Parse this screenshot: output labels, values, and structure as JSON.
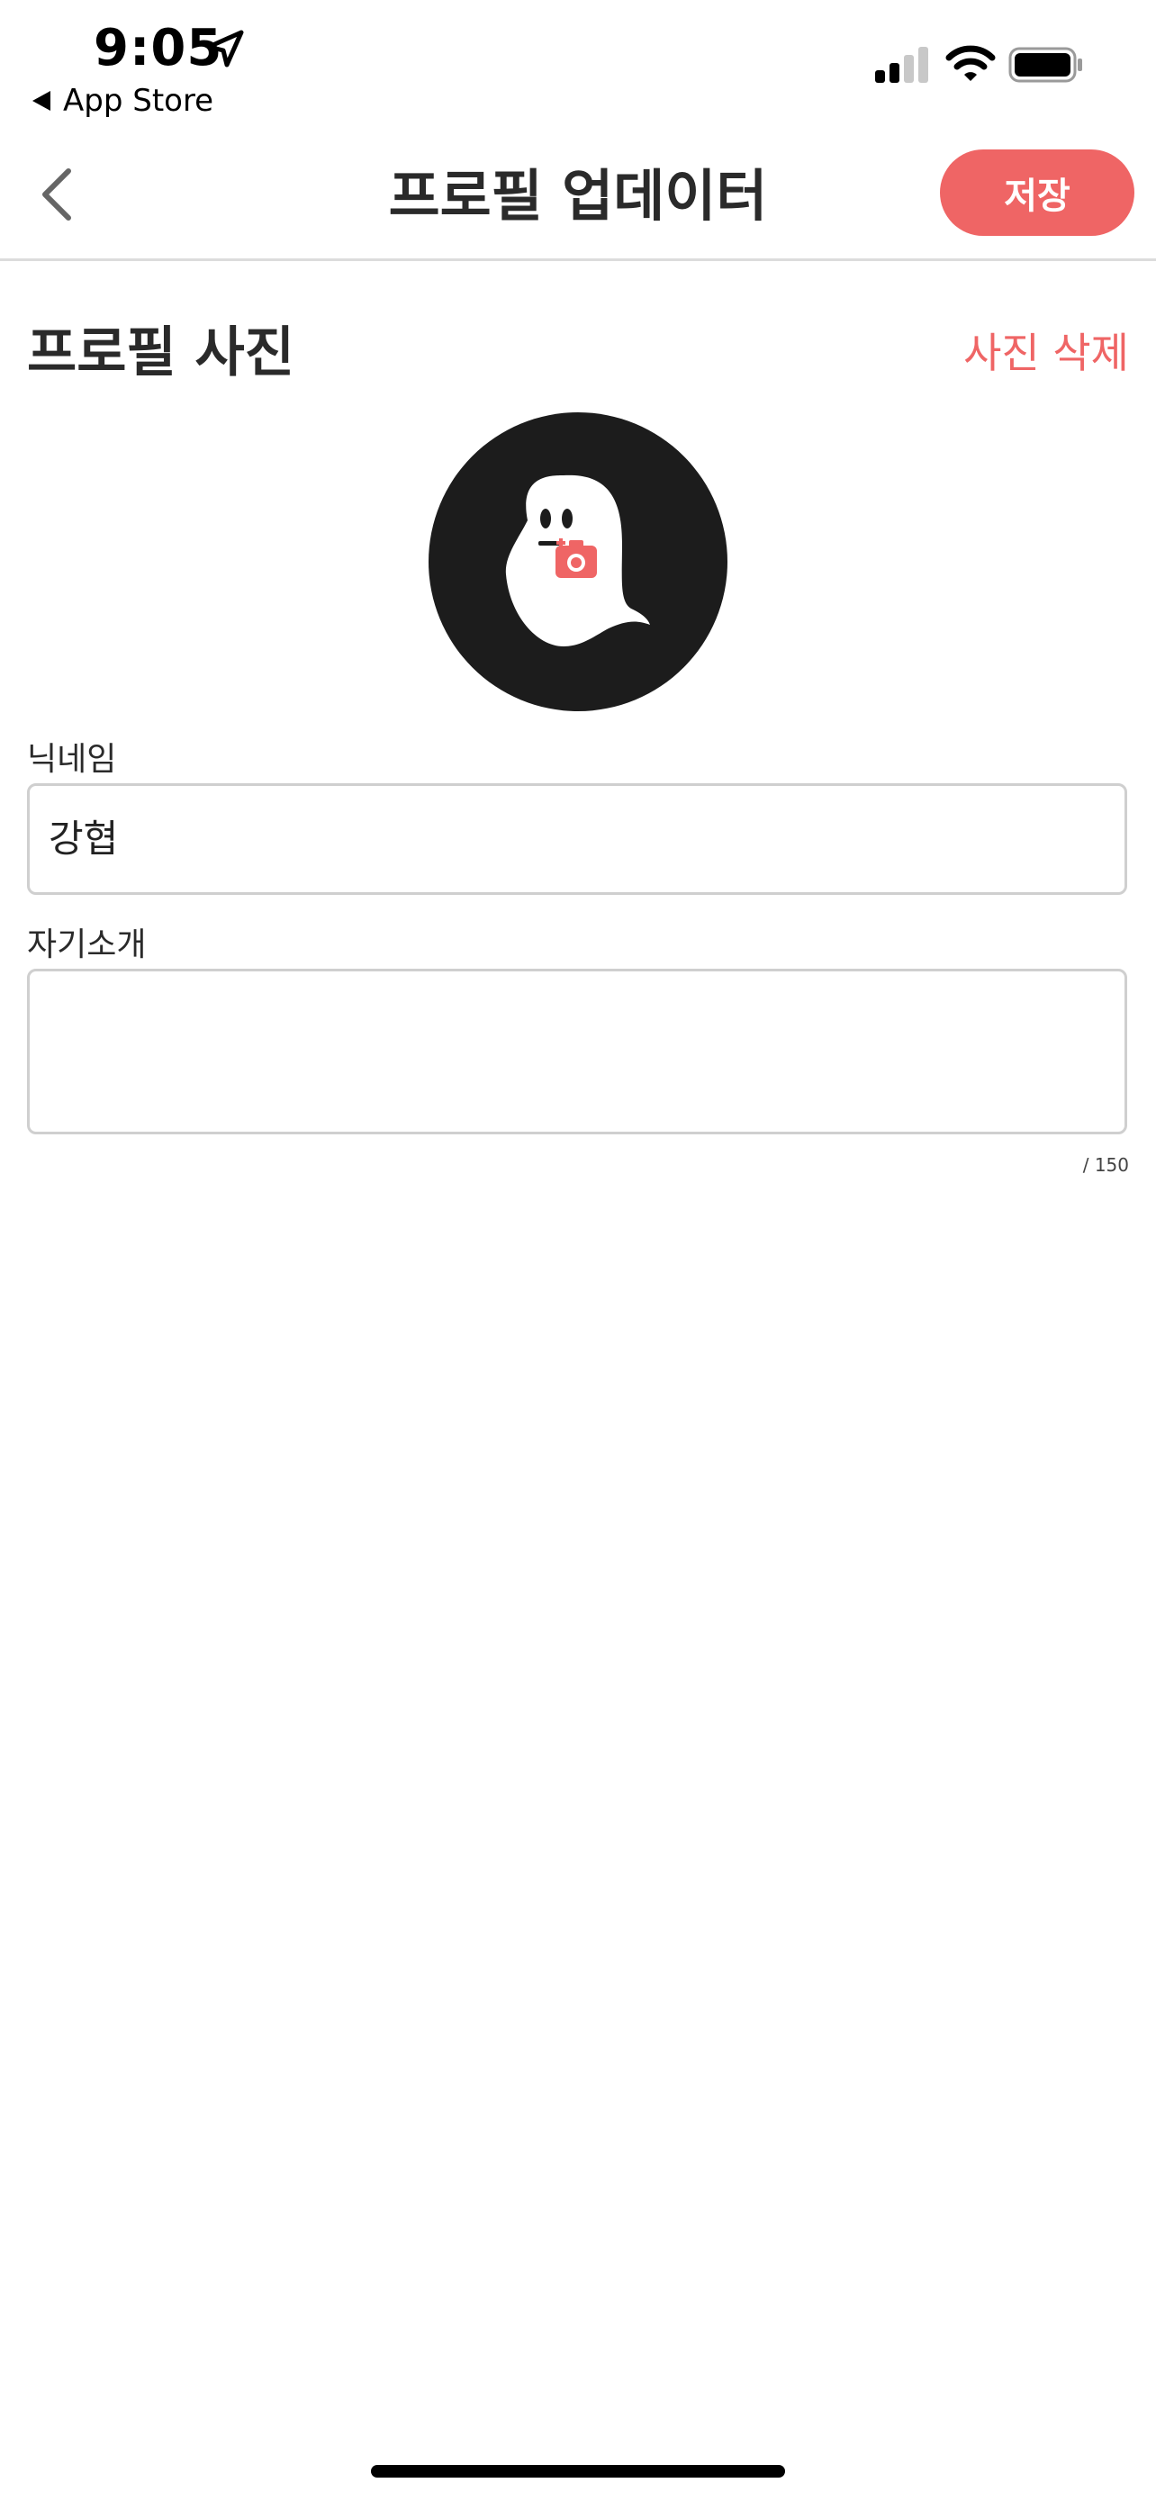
{
  "status_bar": {
    "time": "9:05",
    "back_app_label": "App Store"
  },
  "nav": {
    "title": "프로필 업데이터",
    "save_label": "저장"
  },
  "profile_photo": {
    "section_title": "프로필 사진",
    "delete_label": "사진 삭제"
  },
  "nickname": {
    "label": "닉네임",
    "value": "강협"
  },
  "bio": {
    "label": "자기소개",
    "value": "",
    "counter": "/ 150"
  },
  "colors": {
    "accent": "#ef6565",
    "avatar_bg": "#1c1c1c",
    "border": "#cfcfcf"
  },
  "icons": [
    "location-arrow-icon",
    "back-triangle-icon",
    "cellular-signal-icon",
    "wifi-icon",
    "battery-icon",
    "chevron-left-icon",
    "ghost-avatar-icon",
    "camera-icon"
  ]
}
